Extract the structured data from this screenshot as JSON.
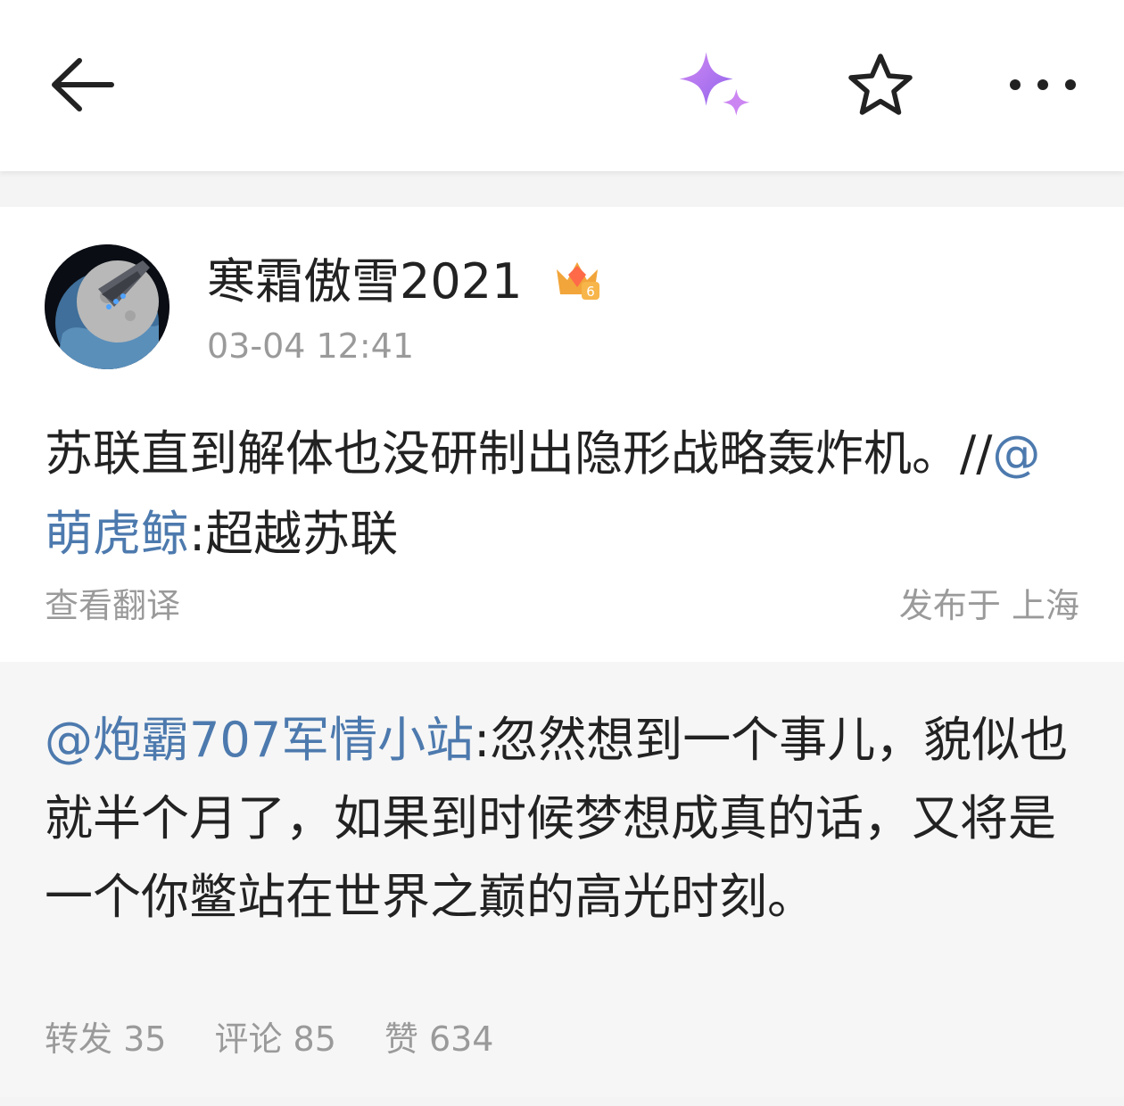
{
  "header": {
    "back_icon": "back-arrow-icon",
    "ai_icon": "sparkle-icon",
    "favorite_icon": "star-icon",
    "more_icon": "more-dots-icon"
  },
  "post": {
    "username": "寒霜傲雪2021",
    "time": "03-04 12:41",
    "content_before": "苏联直到解体也没研制出隐形战略轰炸机。//",
    "mention": "@萌虎鲸",
    "content_after": ":超越苏联",
    "translate_label": "查看翻译",
    "location": "发布于 上海"
  },
  "repost": {
    "mention": "@炮霸707军情小站",
    "text": ":忽然想到一个事儿，貌似也就半个月了，如果到时候梦想成真的话，又将是一个你鳖站在世界之巅的高光时刻。",
    "reposts": "转发 35",
    "comments": "评论 85",
    "likes": "赞 634"
  },
  "colors": {
    "accent": "#4d7aae",
    "muted": "#9a9a9a",
    "badge": "#f2a53a"
  }
}
